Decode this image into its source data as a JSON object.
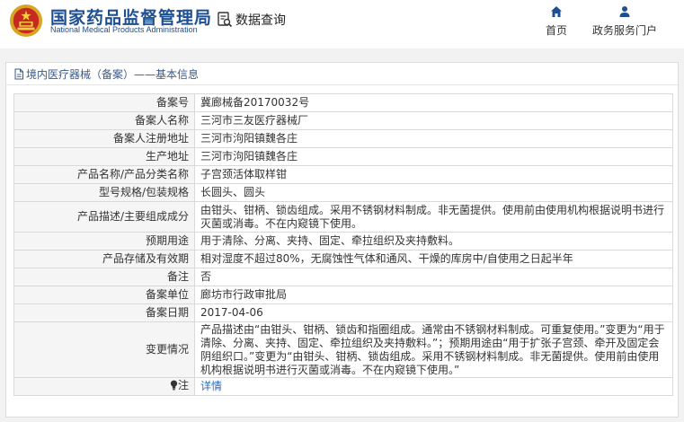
{
  "header": {
    "logo_cn": "国家药品监督管理局",
    "logo_en": "National Medical Products Administration",
    "query_label": "数据查询",
    "nav": [
      {
        "label": "首页",
        "icon": "home-icon"
      },
      {
        "label": "政务服务门户",
        "icon": "user-icon"
      }
    ]
  },
  "panel": {
    "title": "境内医疗器械（备案）——基本信息",
    "rows": [
      {
        "key": "备案号",
        "value": "冀廊械备20170032号"
      },
      {
        "key": "备案人名称",
        "value": "三河市三友医疗器械厂"
      },
      {
        "key": "备案人注册地址",
        "value": "三河市泃阳镇魏各庄"
      },
      {
        "key": "生产地址",
        "value": "三河市泃阳镇魏各庄"
      },
      {
        "key": "产品名称/产品分类名称",
        "value": "子宫颈活体取样钳"
      },
      {
        "key": "型号规格/包装规格",
        "value": "长圆头、圆头"
      },
      {
        "key": "产品描述/主要组成成分",
        "value": "由钳头、钳柄、锁齿组成。采用不锈钢材料制成。非无菌提供。使用前由使用机构根据说明书进行灭菌或消毒。不在内窥镜下使用。"
      },
      {
        "key": "预期用途",
        "value": "用于清除、分离、夹持、固定、牵拉组织及夹持敷料。"
      },
      {
        "key": "产品存储及有效期",
        "value": "相对湿度不超过80%，无腐蚀性气体和通风、干燥的库房中/自使用之日起半年"
      },
      {
        "key": "备注",
        "value": "否"
      },
      {
        "key": "备案单位",
        "value": "廊坊市行政审批局"
      },
      {
        "key": "备案日期",
        "value": "2017-04-06"
      },
      {
        "key": "变更情况",
        "value": "产品描述由“由钳头、钳柄、锁齿和指圈组成。通常由不锈钢材料制成。可重复使用。”变更为“用于清除、分离、夹持、固定、牵拉组织及夹持敷料。”；预期用途由“用于扩张子宫颈、牵开及固定会阴组织口。”变更为“由钳头、钳柄、锁齿组成。采用不锈钢材料制成。非无菌提供。使用前由使用机构根据说明书进行灭菌或消毒。不在内窥镜下使用。”"
      }
    ],
    "note": {
      "key": "注",
      "link": "详情",
      "icon": "lightbulb-icon"
    }
  },
  "colors": {
    "brand": "#1d4f91",
    "link": "#2a6cc3",
    "title": "#3a5a86"
  }
}
